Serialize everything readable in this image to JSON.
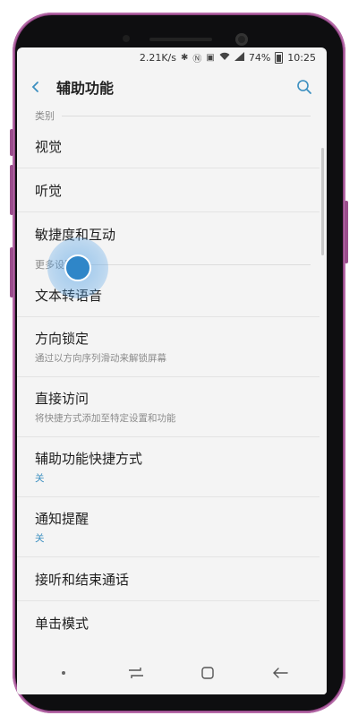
{
  "status": {
    "speed": "2.21K/s",
    "battery": "74%",
    "time": "10:25"
  },
  "appbar": {
    "title": "辅助功能"
  },
  "sections": {
    "category": "类别",
    "more": "更多设置"
  },
  "items": {
    "vision": {
      "title": "视觉"
    },
    "hearing": {
      "title": "听觉"
    },
    "dexterity": {
      "title": "敏捷度和互动"
    },
    "tts": {
      "title": "文本转语音"
    },
    "direction_lock": {
      "title": "方向锁定",
      "subtitle": "通过以方向序列滑动来解锁屏幕"
    },
    "direct_access": {
      "title": "直接访问",
      "subtitle": "将快捷方式添加至特定设置和功能"
    },
    "shortcut": {
      "title": "辅助功能快捷方式",
      "subtitle": "关"
    },
    "notification": {
      "title": "通知提醒",
      "subtitle": "关"
    },
    "answer_end": {
      "title": "接听和结束通话"
    },
    "single_tap": {
      "title": "单击模式"
    }
  },
  "colors": {
    "accent": "#3b8fc0",
    "touch": "#2f86c8",
    "frame": "#8a3f7e"
  },
  "icons": {
    "back": "back-arrow-icon",
    "search": "search-icon",
    "nav_recent": "recent-apps-icon",
    "nav_home": "home-icon",
    "nav_back": "back-icon"
  }
}
